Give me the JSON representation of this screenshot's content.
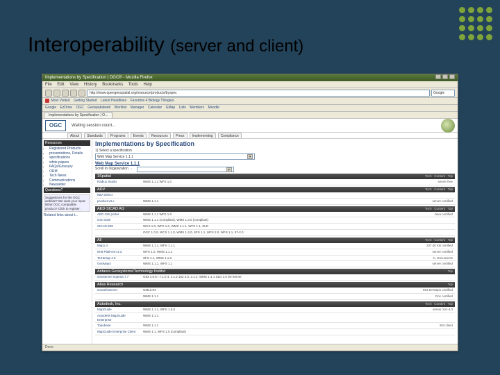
{
  "slide": {
    "title": "Interoperability",
    "subtitle": "(server and client)"
  },
  "window": {
    "title": "Implementations by Specification | OGC® - Mozilla Firefox"
  },
  "menu": {
    "file": "File",
    "edit": "Edit",
    "view": "View",
    "history": "History",
    "bookmarks": "Bookmarks",
    "tools": "Tools",
    "help": "Help"
  },
  "nav": {
    "url": "http://www.opengeospatial.org/resource/products/byspec",
    "go": "Google"
  },
  "bookmarks": {
    "items": [
      "Most Visited",
      "Getting Started",
      "Latest Headlines",
      "Favoritos 4 Biology Thingies"
    ]
  },
  "linkbar": {
    "items": [
      "Google",
      "EzDrive",
      "OGC",
      "Geospatialweb",
      "Worklist",
      "Manager",
      "Calendar",
      "GMap",
      "Lists",
      "Members",
      "Moodle"
    ]
  },
  "tab": {
    "label": "Implementations by Specification | O..."
  },
  "ogc": {
    "logo": "OGC",
    "status": "Waiting  session count...",
    "tabs": [
      "About",
      "Standards",
      "Programs",
      "Events",
      "Resources",
      "Press",
      "Implementing",
      "Compliance"
    ]
  },
  "sidebar": {
    "header1": "Resources",
    "items": [
      "Registered Products",
      "presentations, Details",
      "specifications",
      "white papers",
      "FAQs/Glossary",
      "ORM",
      "Tech News",
      "Communications",
      "Newsletter"
    ],
    "header2": "Questions?",
    "boxtext": "Suggestions for the OGC website? We want your input. NEW OGC compatible product? Click to register.",
    "link": "Related links about t..."
  },
  "main": {
    "title": "Implementations by Specification",
    "step1": "1) Select a specification",
    "spec": "Web Map Service 1.1.1",
    "section": "Web Map Service 1.1.1",
    "step2": "Scroll to Organization →",
    "vendors": [
      {
        "name": "1Spatial",
        "cols": [
          "Tech",
          "Content",
          "Top"
        ],
        "rows": [
          {
            "c1": "Radius Studio",
            "c2": "WMS 1.1.1   WFS 1.0",
            "c3": "server   free"
          }
        ]
      },
      {
        "name": "ADV",
        "cols": [
          "Tech",
          "Content",
          "Top"
        ],
        "rows": [
          {
            "c1": "NBA Direct",
            "c2": "",
            "c3": ""
          },
          {
            "c1": "product v3.x",
            "c2": "WMS 1.1.1",
            "c3": "server   certified"
          }
        ]
      },
      {
        "name": "AED-SICAD AG",
        "cols": [
          "Tech",
          "Content",
          "Top"
        ],
        "rows": [
          {
            "c1": "AED GIS portal",
            "c2": "WMS 1.1.1   WFS 1.0",
            "c3": "Java   certified"
          },
          {
            "c1": "GIS Suite",
            "c2": "WMS 1.1.1 (compliant), WMS 1.3.0 (compliant)",
            "c3": ""
          },
          {
            "c1": "SICAD IMS",
            "c2": "WCS 1.0, WFS 1.0, WMS 1.1.1, WFS 1.1, SLD",
            "c3": ""
          },
          {
            "c1": "",
            "c2": "OGC 1.0.0, WCS 1.1.0, WMS 1.3.0, SFS 1.1, WFS 2.0, WFS 1.1, 97-2.0",
            "c3": ""
          }
        ]
      },
      {
        "name": "All",
        "cols": [
          "Tech",
          "Content",
          "Top"
        ],
        "rows": [
          {
            "c1": "Map1.4",
            "c2": "WMS 1.1.1, WFS 1.1.1",
            "c3": "237.00 KB   certified"
          },
          {
            "c1": "M-B PlatForm 3.3",
            "c2": "WFS 1.0, WMS 1.1.1",
            "c3": "server   certified"
          },
          {
            "c1": "Terramap 4.6",
            "c2": "SFS 1.1, WMS 1.1.0",
            "c3": "C, Documents"
          },
          {
            "c1": "GeoMap4",
            "c2": "WMS 1.1.1, WFS 1.1",
            "c3": "server   certified"
          }
        ]
      },
      {
        "name": "Antares Geosystems/Technology Institut",
        "cols": [
          "",
          "",
          "Top"
        ],
        "rows": [
          {
            "c1": "Geoserver Soperia 7.7",
            "c2": "G93 1.0.6 / 7.1.0 4, 1.1.2 102 3.0, 2.1.4, WMS 1.1.1 SLD 1.0 93-Server",
            "c3": ""
          }
        ]
      },
      {
        "name": "Atlas Research",
        "cols": [
          "",
          "",
          "Top"
        ],
        "rows": [
          {
            "c1": "GeoInfoServer",
            "c2": "GML2.04",
            "c3": "561.00   Maps   certified"
          },
          {
            "c1": "",
            "c2": "WMS 1.1.1",
            "c3": "Doc   certified"
          }
        ]
      },
      {
        "name": "Autodesk, Inc.",
        "cols": [
          "Tech",
          "Content",
          "Top"
        ],
        "rows": [
          {
            "c1": "MapGuide",
            "c2": "WMS 1.1.1, WFS 1.0.0",
            "c3": "server   101-4.0"
          },
          {
            "c1": "Autodesk MapGuide Enterprise",
            "c2": "WMS 1.1.1",
            "c3": ""
          },
          {
            "c1": "Topobase",
            "c2": "WMS 1.1.1",
            "c3": "263   client"
          },
          {
            "c1": "MapGuide Enterprise Client",
            "c2": "WMS 1.1, WFS 1.0 (compliant)",
            "c3": ""
          }
        ]
      }
    ]
  },
  "status": {
    "text": "Done"
  }
}
